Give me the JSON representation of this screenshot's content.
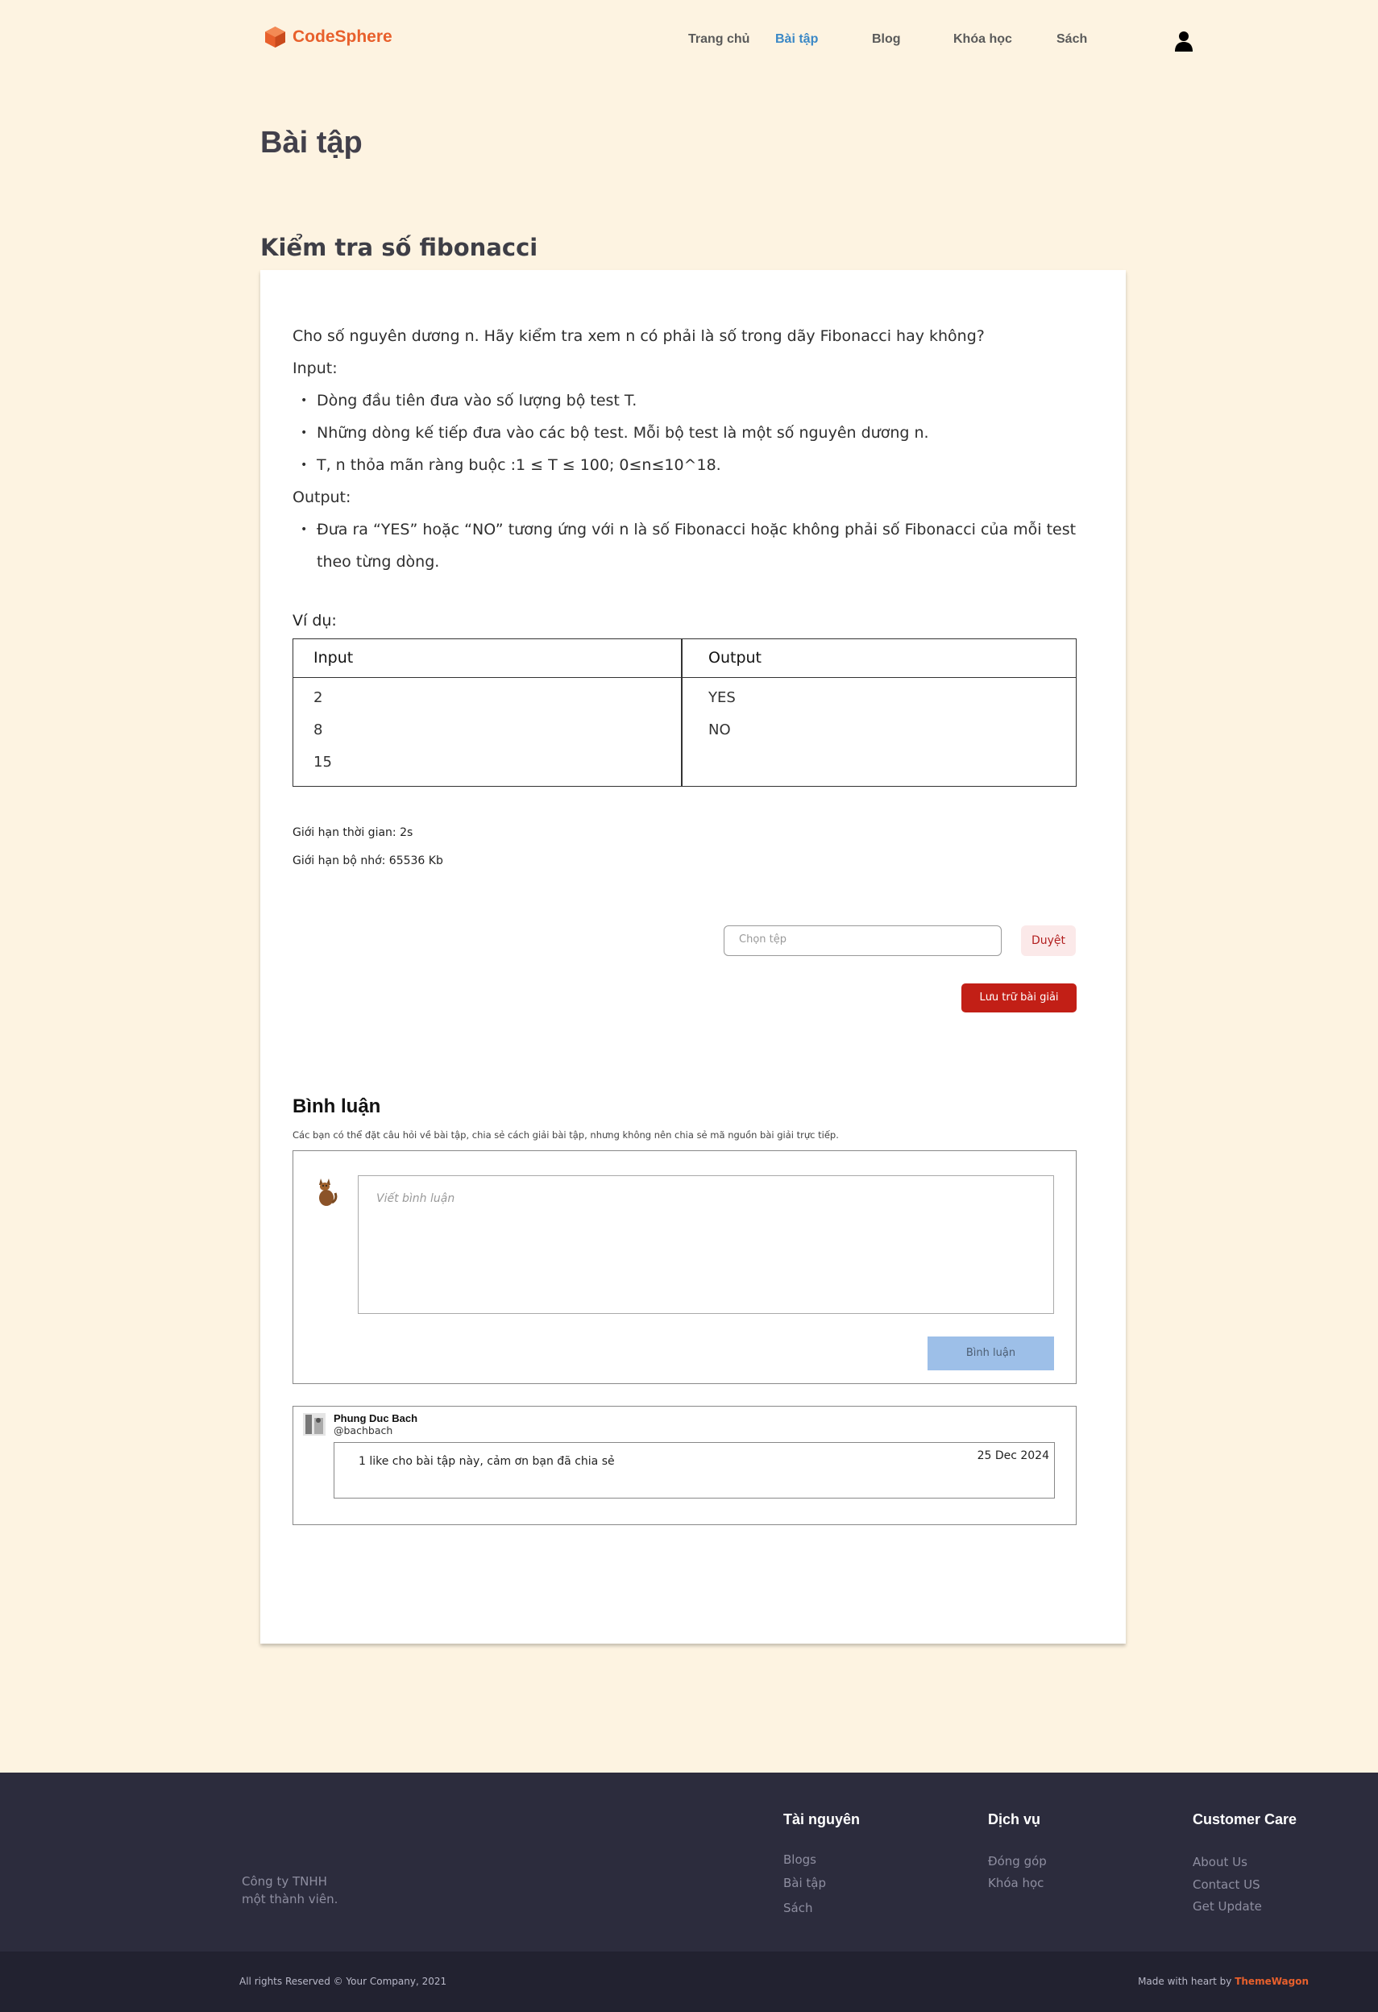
{
  "brand": {
    "name": "CodeSphere",
    "color": "#e8602c"
  },
  "nav": [
    {
      "label": "Trang chủ",
      "active": false
    },
    {
      "label": "Bài tập",
      "active": true
    },
    {
      "label": "Blog",
      "active": false
    },
    {
      "label": "Khóa học",
      "active": false
    },
    {
      "label": "Sách",
      "active": false
    }
  ],
  "icons": {
    "user": "user-icon",
    "logo": "cube-logo-icon"
  },
  "page_title": "Bài tập",
  "problem": {
    "title": "Kiểm tra số fibonacci",
    "intro": "Cho số nguyên dương n. Hãy kiểm tra xem n có phải là số trong dãy Fibonacci hay không?",
    "input_label": "Input:",
    "input_items": [
      "Dòng đầu tiên đưa vào số lượng bộ test T.",
      "Những dòng kế tiếp đưa vào các bộ test. Mỗi bộ test là một số nguyên dương n.",
      "T, n thỏa mãn ràng buộc :1 ≤ T ≤ 100; 0≤n≤10^18."
    ],
    "output_label": "Output:",
    "output_items": [
      "Đưa ra “YES” hoặc “NO” tương ứng với n là số Fibonacci hoặc không phải số Fibonacci của mỗi test theo từng dòng."
    ],
    "example_label": "Ví dụ:",
    "example": {
      "headers": [
        "Input",
        "Output"
      ],
      "input_lines": [
        "2",
        "8",
        "15"
      ],
      "output_lines": [
        "YES",
        "NO"
      ]
    },
    "time_limit": "Giới hạn thời gian: 2s",
    "memory_limit": "Giới hạn bộ nhớ: 65536 Kb"
  },
  "upload": {
    "file_placeholder": "Chọn tệp",
    "browse_label": "Duyệt",
    "save_label": "Lưu trữ bài giải"
  },
  "comments": {
    "title": "Bình luận",
    "subtitle": "Các bạn có thể đặt câu hỏi về bài tập, chia sẻ cách giải bài tập, nhưng không nên chia sẻ mã nguồn bài giải trực tiếp.",
    "textarea_placeholder": "Viết bình luận",
    "submit_label": "Bình luận",
    "posts": [
      {
        "name": "Phung Duc Bach",
        "handle": "@bachbach",
        "text": "1 like cho bài tập này, cảm ơn bạn đã chia sẻ",
        "date": "25 Dec 2024"
      }
    ]
  },
  "footer": {
    "company_line1": "Công ty TNHH",
    "company_line2": "một thành viên.",
    "columns": [
      {
        "title": "Tài nguyên",
        "links": [
          "Blogs",
          "Bài tập",
          "Sách"
        ]
      },
      {
        "title": "Dịch vụ",
        "links": [
          "Đóng góp",
          "Khóa học"
        ]
      },
      {
        "title": "Customer Care",
        "links": [
          "About Us",
          "Contact US",
          "Get Update"
        ]
      }
    ],
    "copyright": "All rights Reserved © Your Company, 2021",
    "made_with": "Made with heart by",
    "made_brand": "ThemeWagon"
  }
}
